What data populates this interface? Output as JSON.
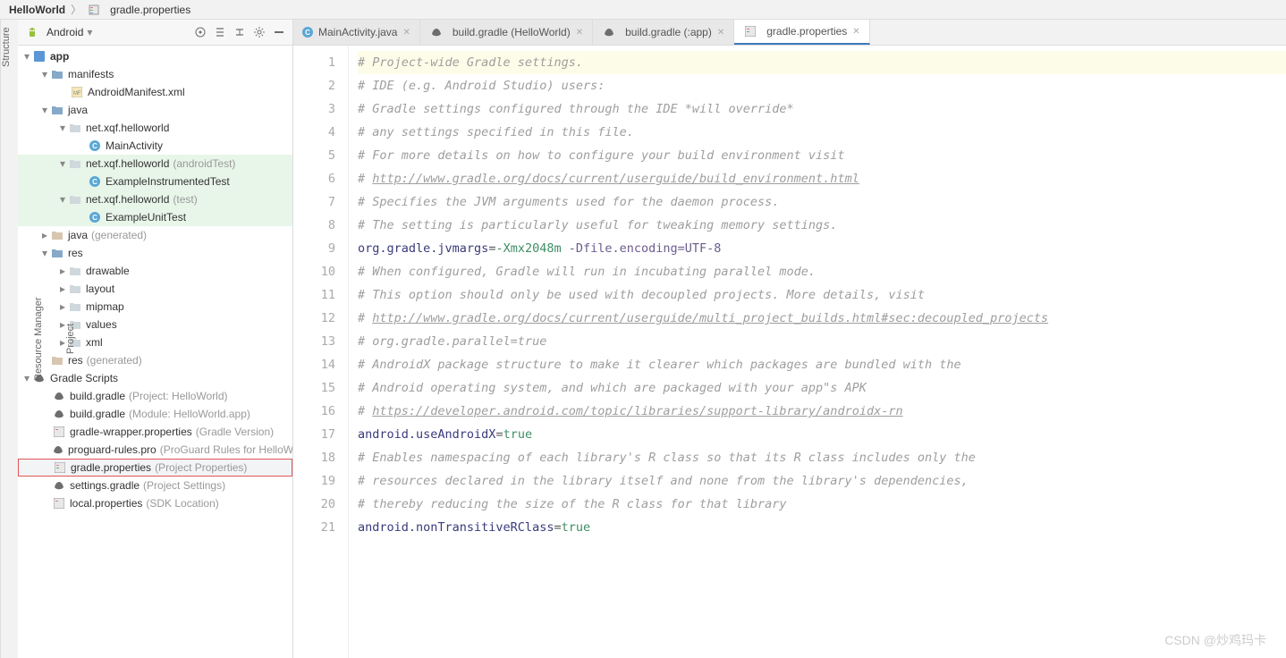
{
  "breadcrumb": {
    "project": "HelloWorld",
    "file": "gradle.properties"
  },
  "sidebar": {
    "mode": "Android",
    "tree": {
      "app": "app",
      "manifests": "manifests",
      "manifest_file": "AndroidManifest.xml",
      "java": "java",
      "pkg_main": "net.xqf.helloworld",
      "main_activity": "MainActivity",
      "pkg_android_test": "net.xqf.helloworld",
      "pkg_android_test_note": "(androidTest)",
      "instr_test": "ExampleInstrumentedTest",
      "pkg_test": "net.xqf.helloworld",
      "pkg_test_note": "(test)",
      "unit_test": "ExampleUnitTest",
      "java_gen": "java",
      "java_gen_note": "(generated)",
      "res": "res",
      "drawable": "drawable",
      "layout": "layout",
      "mipmap": "mipmap",
      "values": "values",
      "xml": "xml",
      "res_gen": "res",
      "res_gen_note": "(generated)",
      "gradle_scripts": "Gradle Scripts",
      "bg_project": "build.gradle",
      "bg_project_note": "(Project: HelloWorld)",
      "bg_module": "build.gradle",
      "bg_module_note": "(Module: HelloWorld.app)",
      "wrapper": "gradle-wrapper.properties",
      "wrapper_note": "(Gradle Version)",
      "proguard": "proguard-rules.pro",
      "proguard_note": "(ProGuard Rules for HelloWorld.app)",
      "gradle_props": "gradle.properties",
      "gradle_props_note": "(Project Properties)",
      "settings": "settings.gradle",
      "settings_note": "(Project Settings)",
      "local_props": "local.properties",
      "local_props_note": "(SDK Location)"
    }
  },
  "left_rail": {
    "project": "Project",
    "resmgr": "Resource Manager",
    "structure": "Structure"
  },
  "tabs": [
    {
      "icon": "class",
      "label": "MainActivity.java"
    },
    {
      "icon": "gradle",
      "label": "build.gradle (HelloWorld)"
    },
    {
      "icon": "gradle",
      "label": "build.gradle (:app)"
    },
    {
      "icon": "props",
      "label": "gradle.properties",
      "active": true
    }
  ],
  "code": {
    "lines": [
      {
        "n": 1,
        "hl": true,
        "parts": [
          {
            "t": "# Project-wide Gradle settings.",
            "cls": "c-comment"
          }
        ]
      },
      {
        "n": 2,
        "parts": [
          {
            "t": "# IDE (e.g. Android Studio) users:",
            "cls": "c-comment"
          }
        ]
      },
      {
        "n": 3,
        "parts": [
          {
            "t": "# Gradle settings configured through the IDE *will override*",
            "cls": "c-comment"
          }
        ]
      },
      {
        "n": 4,
        "parts": [
          {
            "t": "# any settings specified in this file.",
            "cls": "c-comment"
          }
        ]
      },
      {
        "n": 5,
        "parts": [
          {
            "t": "# For more details on how to configure your build environment visit",
            "cls": "c-comment"
          }
        ]
      },
      {
        "n": 6,
        "parts": [
          {
            "t": "# ",
            "cls": "c-comment"
          },
          {
            "t": "http://www.gradle.org/docs/current/userguide/build_environment.html",
            "cls": "c-comment c-link"
          }
        ]
      },
      {
        "n": 7,
        "parts": [
          {
            "t": "# Specifies the JVM arguments used for the daemon process.",
            "cls": "c-comment"
          }
        ]
      },
      {
        "n": 8,
        "parts": [
          {
            "t": "# The setting is particularly useful for tweaking memory settings.",
            "cls": "c-comment"
          }
        ]
      },
      {
        "n": 9,
        "parts": [
          {
            "t": "org.gradle.jvmargs",
            "cls": "c-key"
          },
          {
            "t": "=",
            "cls": "c-eq"
          },
          {
            "t": "-Xmx2048m ",
            "cls": "c-val"
          },
          {
            "t": "-Dfile.encoding=UTF-8",
            "cls": "c-arg"
          }
        ]
      },
      {
        "n": 10,
        "parts": [
          {
            "t": "# When configured, Gradle will run in incubating parallel mode.",
            "cls": "c-comment"
          }
        ]
      },
      {
        "n": 11,
        "parts": [
          {
            "t": "# This option should only be used with decoupled projects. More details, visit",
            "cls": "c-comment"
          }
        ]
      },
      {
        "n": 12,
        "parts": [
          {
            "t": "# ",
            "cls": "c-comment"
          },
          {
            "t": "http://www.gradle.org/docs/current/userguide/multi_project_builds.html#sec:decoupled_projects",
            "cls": "c-comment c-link"
          }
        ]
      },
      {
        "n": 13,
        "parts": [
          {
            "t": "# org.gradle.parallel=true",
            "cls": "c-comment"
          }
        ]
      },
      {
        "n": 14,
        "parts": [
          {
            "t": "# AndroidX package structure to make it clearer which packages are bundled with the",
            "cls": "c-comment"
          }
        ]
      },
      {
        "n": 15,
        "parts": [
          {
            "t": "# Android operating system, and which are packaged with your app\"s APK",
            "cls": "c-comment"
          }
        ]
      },
      {
        "n": 16,
        "parts": [
          {
            "t": "# ",
            "cls": "c-comment"
          },
          {
            "t": "https://developer.android.com/topic/libraries/support-library/androidx-rn",
            "cls": "c-comment c-link"
          }
        ]
      },
      {
        "n": 17,
        "parts": [
          {
            "t": "android.useAndroidX",
            "cls": "c-key"
          },
          {
            "t": "=",
            "cls": "c-eq"
          },
          {
            "t": "true",
            "cls": "c-val"
          }
        ]
      },
      {
        "n": 18,
        "parts": [
          {
            "t": "# Enables namespacing of each library's R class so that its R class includes only the",
            "cls": "c-comment"
          }
        ]
      },
      {
        "n": 19,
        "parts": [
          {
            "t": "# resources declared in the library itself and none from the library's dependencies,",
            "cls": "c-comment"
          }
        ]
      },
      {
        "n": 20,
        "parts": [
          {
            "t": "# thereby reducing the size of the R class for that library",
            "cls": "c-comment"
          }
        ]
      },
      {
        "n": 21,
        "parts": [
          {
            "t": "android.nonTransitiveRClass",
            "cls": "c-key"
          },
          {
            "t": "=",
            "cls": "c-eq"
          },
          {
            "t": "true",
            "cls": "c-val"
          }
        ]
      }
    ]
  },
  "watermark": "CSDN @炒鸡玛卡"
}
